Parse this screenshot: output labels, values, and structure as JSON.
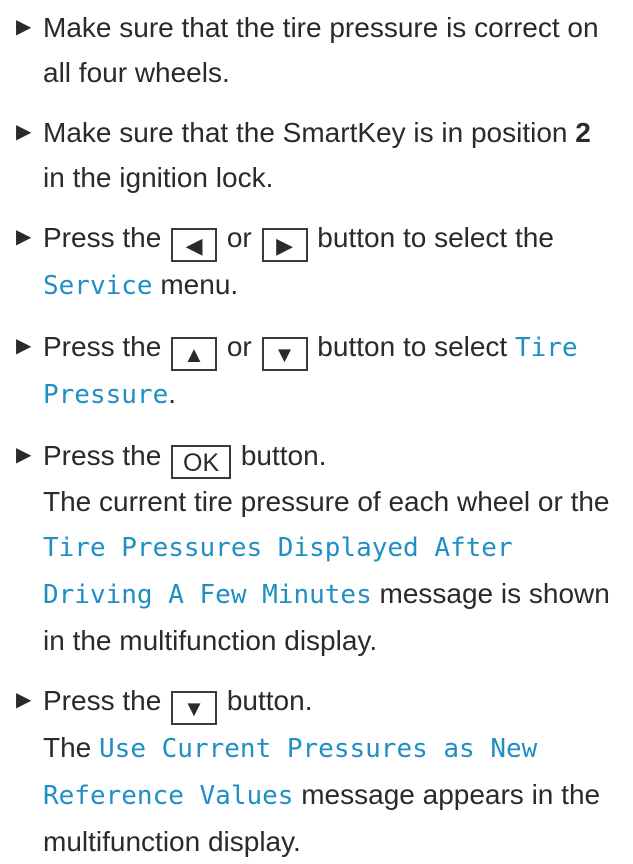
{
  "bullet_icon": "right-triangle-icon",
  "steps": [
    {
      "text": "Make sure that the tire pressure is correct on all four wheels."
    },
    {
      "pre": "Make sure that the SmartKey is in position ",
      "bold": "2",
      "post": " in the ignition lock."
    },
    {
      "pre": "Press the ",
      "key1": "◀",
      "mid": " or ",
      "key2": "▶",
      "post": " button to select the ",
      "menu": "Service",
      "end": " menu."
    },
    {
      "pre": "Press the ",
      "key1": "▲",
      "mid": " or ",
      "key2": "▼",
      "post": " button to select ",
      "menu": "Tire Pressure",
      "end": "."
    },
    {
      "pre": "Press the ",
      "key": "OK",
      "post": " button.",
      "result_pre": "The current tire pressure of each wheel or the ",
      "result_msg": "Tire Pressures Displayed After Driving A Few Minutes",
      "result_post": " message is shown in the multifunction display."
    },
    {
      "pre": "Press the ",
      "key": "▼",
      "post": " button.",
      "result_pre": "The ",
      "result_msg": "Use Current Pressures as New Reference Values",
      "result_post": " message appears in the multifunction display."
    }
  ]
}
